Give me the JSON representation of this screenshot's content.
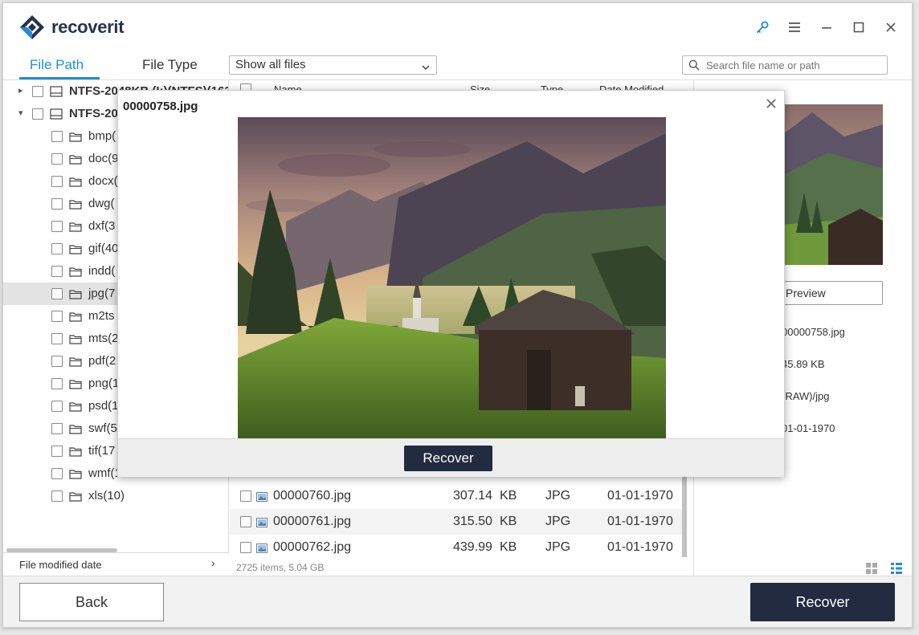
{
  "app": {
    "name": "recoverit"
  },
  "tabs": {
    "file_path": "File Path",
    "file_type": "File Type"
  },
  "filter": {
    "selected": "Show all files"
  },
  "search": {
    "placeholder": "Search file name or path"
  },
  "tree": {
    "drives": [
      {
        "label": "NTFS-2048KB (I:)(NTFS)(163"
      },
      {
        "label": "NTFS-20"
      }
    ],
    "folders": [
      {
        "label": "bmp("
      },
      {
        "label": "doc(9"
      },
      {
        "label": "docx("
      },
      {
        "label": "dwg("
      },
      {
        "label": "dxf(3"
      },
      {
        "label": "gif(40"
      },
      {
        "label": "indd("
      },
      {
        "label": "jpg(7"
      },
      {
        "label": "m2ts"
      },
      {
        "label": "mts(2"
      },
      {
        "label": "pdf(2"
      },
      {
        "label": "png(1"
      },
      {
        "label": "psd(1"
      },
      {
        "label": "swf(5"
      },
      {
        "label": "tif(17"
      },
      {
        "label": "wmf(1"
      },
      {
        "label": "xls(10)"
      }
    ],
    "filter_label": "File modified date"
  },
  "list": {
    "columns": {
      "name": "Name",
      "size": "Size",
      "type": "Type",
      "date": "Date Modified"
    },
    "rows": [
      {
        "name": "00000760.jpg",
        "size": "307.14",
        "unit": "KB",
        "type": "JPG",
        "date": "01-01-1970"
      },
      {
        "name": "00000761.jpg",
        "size": "315.50",
        "unit": "KB",
        "type": "JPG",
        "date": "01-01-1970"
      },
      {
        "name": "00000762.jpg",
        "size": "439.99",
        "unit": "KB",
        "type": "JPG",
        "date": "01-01-1970"
      }
    ],
    "footer": "2725 items, 5.04  GB"
  },
  "info": {
    "preview_btn": "Preview",
    "name": "00000758.jpg",
    "size": "45.89  KB",
    "path": "(RAW)/jpg",
    "date": "01-01-1970"
  },
  "modal": {
    "title": "00000758.jpg",
    "recover": "Recover"
  },
  "bottom": {
    "back": "Back",
    "recover": "Recover"
  },
  "colors": {
    "accent": "#1d8fd6",
    "dark_button": "#222b40"
  },
  "icons": [
    "key-icon",
    "menu-icon",
    "minimize-icon",
    "maximize-icon",
    "close-icon",
    "search-icon",
    "drive-icon",
    "folder-icon",
    "image-file-icon",
    "grid-view-icon",
    "list-view-icon"
  ]
}
